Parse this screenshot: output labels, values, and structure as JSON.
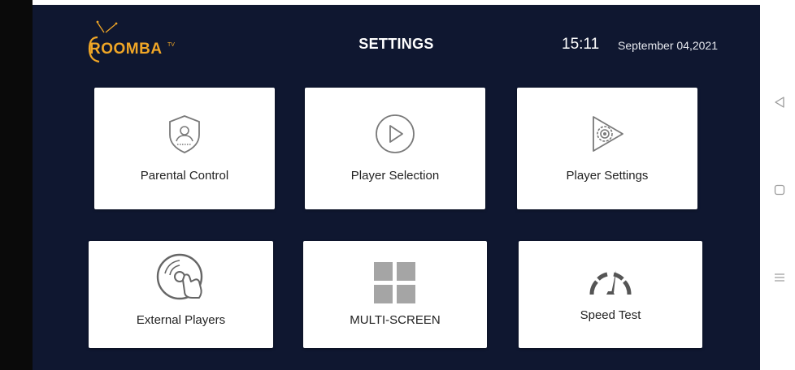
{
  "header": {
    "logo_text": "ROOMBA",
    "logo_superscript": "TV",
    "title": "SETTINGS",
    "time": "15:11",
    "date": "September 04,2021"
  },
  "tiles": [
    {
      "label": "Parental Control",
      "icon": "shield-user-icon"
    },
    {
      "label": "Player Selection",
      "icon": "play-circle-icon"
    },
    {
      "label": "Player Settings",
      "icon": "play-gear-icon"
    },
    {
      "label": "External Players",
      "icon": "disc-hand-icon"
    },
    {
      "label": "MULTI-SCREEN",
      "icon": "grid-four-icon"
    },
    {
      "label": "Speed Test",
      "icon": "speedometer-icon"
    }
  ],
  "nav": {
    "items": [
      "back",
      "home",
      "recents"
    ]
  },
  "colors": {
    "app_background": "#0f1730",
    "brand_orange": "#f0a626",
    "tile_background": "#ffffff",
    "icon_gray": "#7a7a7a"
  }
}
